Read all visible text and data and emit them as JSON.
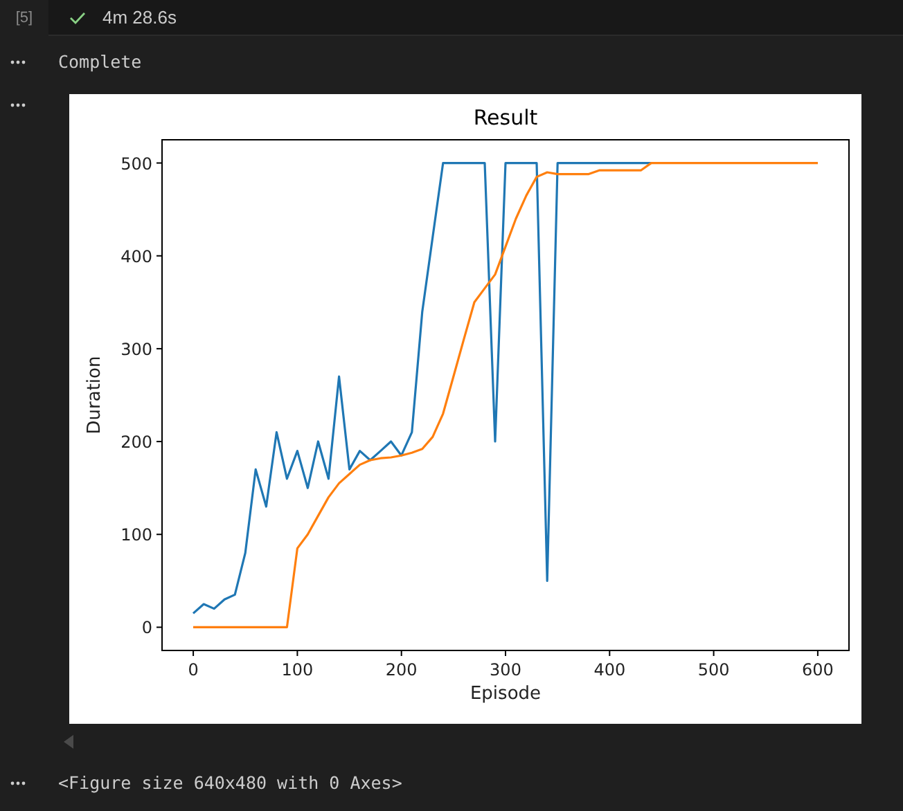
{
  "cell": {
    "execution_count": "[5]",
    "succeeded": true,
    "duration": "4m 28.6s"
  },
  "outputs": [
    {
      "kind": "text",
      "text": "Complete"
    },
    {
      "kind": "figure",
      "chart_data": {
        "type": "line",
        "title": "Result",
        "xlabel": "Episode",
        "ylabel": "Duration",
        "xlim": [
          -30,
          630
        ],
        "ylim": [
          -25,
          525
        ],
        "xticks": [
          0,
          100,
          200,
          300,
          400,
          500,
          600
        ],
        "yticks": [
          0,
          100,
          200,
          300,
          400,
          500
        ],
        "x": [
          0,
          10,
          20,
          30,
          40,
          50,
          60,
          70,
          80,
          90,
          100,
          110,
          120,
          130,
          140,
          150,
          160,
          170,
          180,
          190,
          200,
          210,
          220,
          230,
          240,
          250,
          260,
          270,
          280,
          290,
          300,
          310,
          320,
          330,
          340,
          350,
          360,
          370,
          380,
          390,
          400,
          410,
          420,
          430,
          440,
          450,
          460,
          470,
          480,
          490,
          500,
          510,
          520,
          530,
          540,
          550,
          560,
          570,
          580,
          590,
          600
        ],
        "series": [
          {
            "color": "#1f77b4",
            "values": [
              15,
              25,
              20,
              30,
              35,
              80,
              170,
              130,
              210,
              160,
              190,
              150,
              200,
              160,
              270,
              170,
              190,
              180,
              190,
              200,
              185,
              210,
              340,
              420,
              500,
              500,
              500,
              500,
              500,
              200,
              500,
              500,
              500,
              500,
              50,
              500,
              500,
              500,
              500,
              500,
              500,
              500,
              500,
              500,
              500,
              null,
              null,
              null,
              null,
              null,
              null,
              null,
              null,
              null,
              null,
              null,
              null,
              null,
              null,
              null,
              null
            ]
          },
          {
            "color": "#ff7f0e",
            "values": [
              0,
              0,
              0,
              0,
              0,
              0,
              0,
              0,
              0,
              0,
              85,
              100,
              120,
              140,
              155,
              165,
              175,
              180,
              182,
              183,
              185,
              188,
              192,
              205,
              230,
              270,
              310,
              350,
              365,
              380,
              410,
              440,
              465,
              485,
              490,
              488,
              488,
              488,
              488,
              492,
              492,
              492,
              492,
              492,
              500,
              500,
              500,
              500,
              500,
              500,
              500,
              500,
              500,
              500,
              500,
              500,
              500,
              500,
              500,
              500,
              500
            ]
          }
        ]
      }
    },
    {
      "kind": "text",
      "text": "<Figure size 640x480 with 0 Axes>"
    }
  ]
}
